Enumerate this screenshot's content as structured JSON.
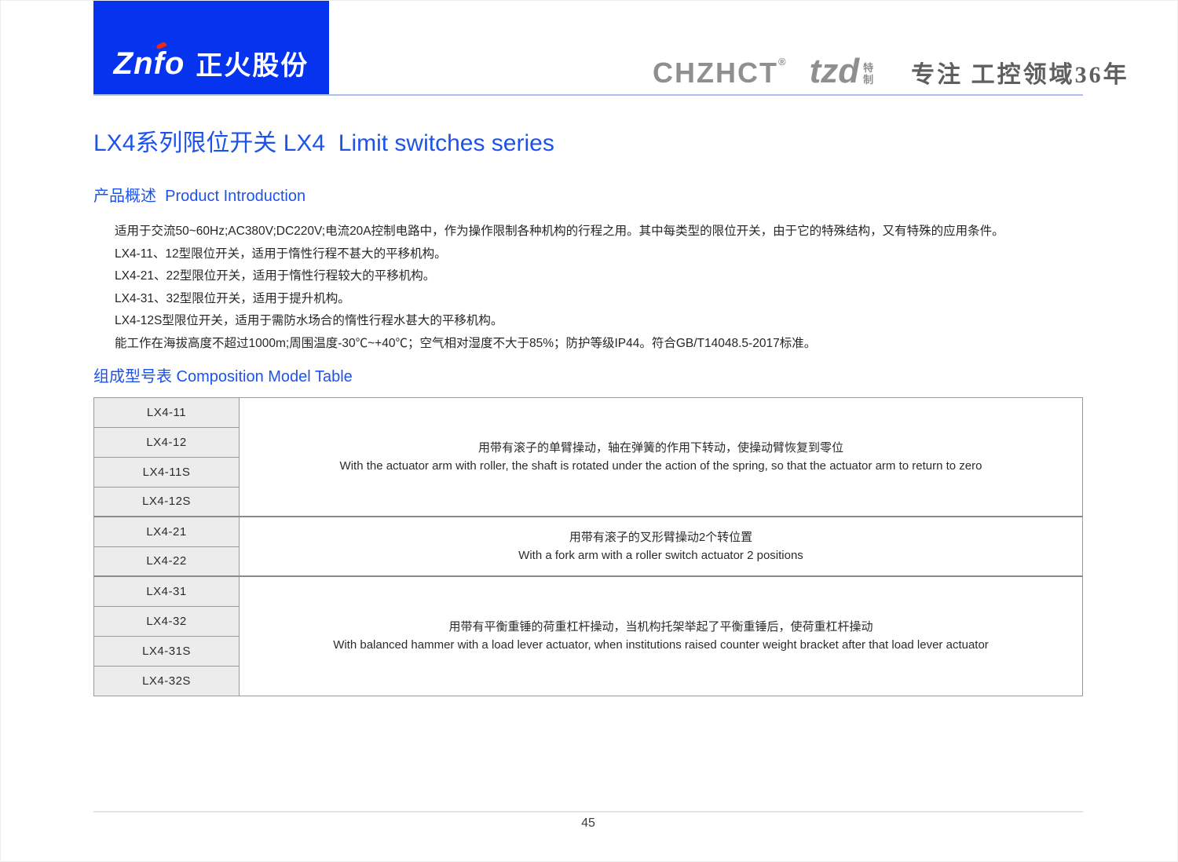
{
  "header": {
    "logo": {
      "latin_pre": "Zn",
      "latin_f": "f",
      "latin_post": "o",
      "cn": "正火股份"
    },
    "brand": {
      "name": "CHZHCT",
      "registered": "®",
      "sub_brand": "tzd",
      "sub_brand_tag_1": "特",
      "sub_brand_tag_2": "制",
      "slogan": "专注 工控领域36年"
    }
  },
  "page_title": "LX4系列限位开关 LX4  Limit switches series",
  "intro": {
    "heading": "产品概述  Product Introduction",
    "lines": [
      "适用于交流50~60Hz;AC380V;DC220V;电流20A控制电路中，作为操作限制各种机构的行程之用。其中每类型的限位开关，由于它的特殊结构，又有特殊的应用条件。",
      "LX4-11、12型限位开关，适用于惰性行程不甚大的平移机构。",
      "LX4-21、22型限位开关，适用于惰性行程较大的平移机构。",
      "LX4-31、32型限位开关，适用于提升机构。",
      "LX4-12S型限位开关，适用于需防水场合的惰性行程水甚大的平移机构。",
      "能工作在海拔高度不超过1000m;周围温度-30℃~+40℃；空气相对湿度不大于85%；防护等级IP44。符合GB/T14048.5-2017标准。"
    ]
  },
  "model_table": {
    "heading": "组成型号表 Composition Model Table",
    "groups": [
      {
        "models": [
          "LX4-11",
          "LX4-12",
          "LX4-11S",
          "LX4-12S"
        ],
        "desc_cn": "用带有滚子的单臂操动，轴在弹簧的作用下转动，使操动臂恢复到零位",
        "desc_en": "With the actuator arm with roller, the shaft is rotated under the action of the spring, so that the actuator arm to return to zero"
      },
      {
        "models": [
          "LX4-21",
          "LX4-22"
        ],
        "desc_cn": "用带有滚子的叉形臂操动2个转位置",
        "desc_en": "With a fork arm with a roller switch actuator 2 positions"
      },
      {
        "models": [
          "LX4-31",
          "LX4-32",
          "LX4-31S",
          "LX4-32S"
        ],
        "desc_cn": "用带有平衡重锤的荷重杠杆操动，当机构托架举起了平衡重锤后，使荷重杠杆操动",
        "desc_en": "With balanced hammer with a load lever actuator, when institutions raised counter weight bracket after that load lever actuator"
      }
    ]
  },
  "footer": {
    "page_number": "45"
  },
  "colors": {
    "logo_blue": "#0533ee",
    "heading_blue": "#1d53e9",
    "accent_red": "#e8291c",
    "header_gray": "#8f8f8f",
    "table_border": "#9b9b9b",
    "model_cell_bg": "#ececec"
  }
}
